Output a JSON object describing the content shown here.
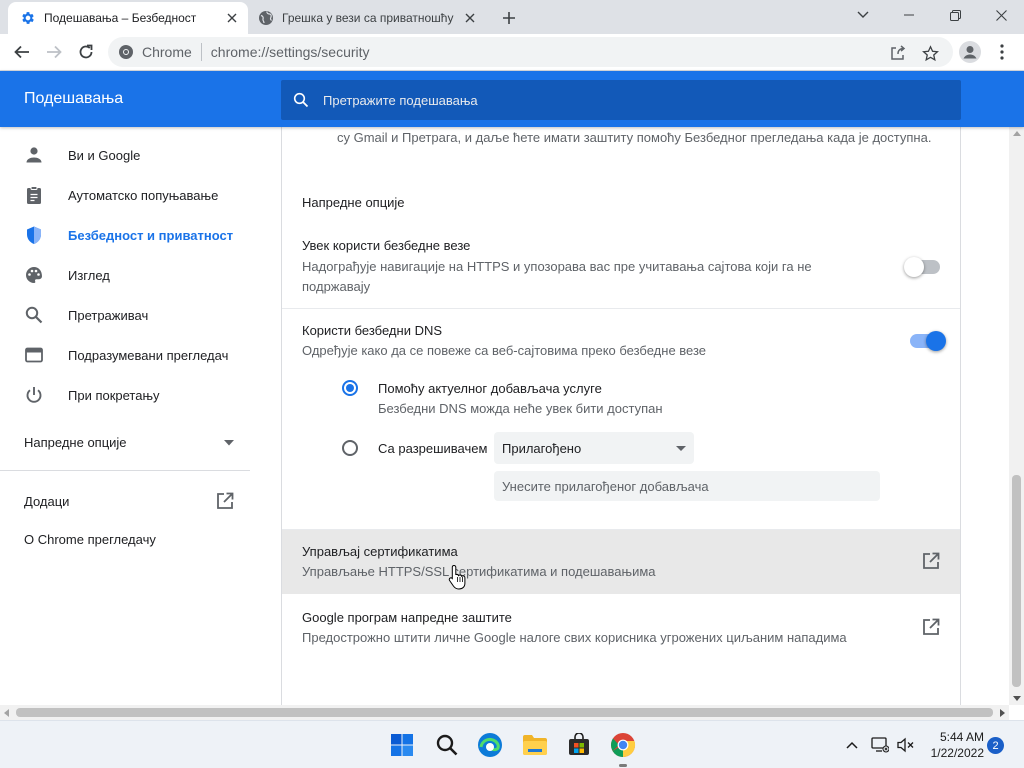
{
  "browser": {
    "tabs": [
      {
        "title": "Подешавања – Безбедност",
        "active": true,
        "icon": "gear-icon"
      },
      {
        "title": "Грешка у вези са приватношћу",
        "active": false,
        "icon": "globe-icon"
      }
    ],
    "omnibox": {
      "site_label": "Chrome",
      "url_scheme": "chrome://",
      "url_path": "settings/security"
    }
  },
  "settings": {
    "header_title": "Подешавања",
    "search_placeholder": "Претражите подешавања"
  },
  "sidebar": {
    "items": [
      {
        "label": "Ви и Google",
        "icon": "person-icon"
      },
      {
        "label": "Аутоматско попуњавање",
        "icon": "clipboard-icon"
      },
      {
        "label": "Безбедност и приватност",
        "icon": "shield-icon",
        "selected": true
      },
      {
        "label": "Изглед",
        "icon": "palette-icon"
      },
      {
        "label": "Претраживач",
        "icon": "search-icon"
      },
      {
        "label": "Подразумевани прегледач",
        "icon": "browser-window-icon"
      },
      {
        "label": "При покретању",
        "icon": "power-icon"
      }
    ],
    "advanced_label": "Напредне опције",
    "extensions_label": "Додаци",
    "about_label": "О Chrome прегледачу"
  },
  "main": {
    "intro_tail": "су Gmail и Претрага, и даље ћете имати заштиту помоћу Безбедног прегледања када је доступна.",
    "advanced_heading": "Напредне опције",
    "https": {
      "title": "Увек користи безбедне везе",
      "description_line1": "Надограђује навигације на HTTPS и упозорава вас пре учитавања сајтова који га не",
      "description_line2": "подржавају",
      "enabled": false
    },
    "dns": {
      "title": "Користи безбедни DNS",
      "description": "Одређује како да се повеже са веб-сајтовима преко безбедне везе",
      "enabled": true,
      "option_current": {
        "label": "Помоћу актуелног добављача услуге",
        "sublabel": "Безбедни DNS можда неће увек бити доступан",
        "selected": true
      },
      "option_custom": {
        "label": "Са разрешивачем",
        "selected": false,
        "select_value": "Прилагођено",
        "input_placeholder": "Унесите прилагођеног добављача"
      }
    },
    "certificates": {
      "title": "Управљај сертификатима",
      "description": "Управљање HTTPS/SSL сертификатима и подешавањима"
    },
    "advanced_protection": {
      "title": "Google програм напредне заштите",
      "description": "Предострожно штити личне Google налоге свих корисника угрожених циљаним нападима"
    }
  },
  "taskbar": {
    "apps": [
      "start-icon",
      "search-icon",
      "edge-icon",
      "file-explorer-icon",
      "store-icon",
      "chrome-icon"
    ],
    "time": "5:44 AM",
    "date": "1/22/2022",
    "notification_count": "2"
  },
  "colors": {
    "accent": "#1a73e8",
    "header_bg": "#1a73e8",
    "search_bg": "#1259b8",
    "tabstrip_bg": "#dee1e6"
  }
}
